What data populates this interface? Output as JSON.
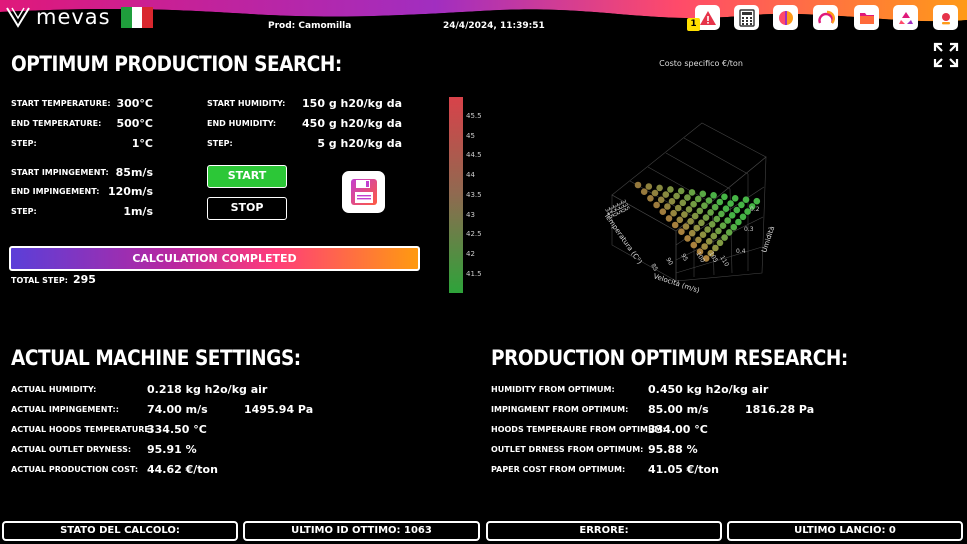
{
  "header": {
    "brand": "mevas",
    "product": "Prod: Camomilla",
    "datetime": "24/4/2024, 11:39:51",
    "warning_badge": "1",
    "icons": [
      "alert-icon",
      "calculator-icon",
      "gauge-icon",
      "arc-icon",
      "folder-icon",
      "recycle-icon",
      "settings-icon"
    ]
  },
  "search": {
    "title": "OPTIMUM PRODUCTION SEARCH:",
    "start_temperature_label": "START TEMPERATURE:",
    "start_temperature": "300°C",
    "end_temperature_label": "END TEMPERATURE:",
    "end_temperature": "500°C",
    "temp_step_label": "STEP:",
    "temp_step": "1°C",
    "start_humidity_label": "START HUMIDITY:",
    "start_humidity": "150 g h20/kg da",
    "end_humidity_label": "END HUMIDITY:",
    "end_humidity": "450 g h20/kg da",
    "hum_step_label": "STEP:",
    "hum_step": "5 g h20/kg da",
    "start_impingement_label": "START IMPINGEMENT:",
    "start_impingement": "85m/s",
    "end_impingement_label": "END IMPINGEMENT:",
    "end_impingement": "120m/s",
    "imp_step_label": "STEP:",
    "imp_step": "1m/s",
    "start_button": "START",
    "stop_button": "STOP",
    "status": "CALCULATION COMPLETED",
    "progress": 1.0,
    "total_step_label": "TOTAL STEP:",
    "total_step": "295"
  },
  "chart": {
    "title": "Costo specifico €/ton",
    "colorbar_ticks": [
      "45.5",
      "45",
      "44.5",
      "44",
      "43.5",
      "43",
      "42.5",
      "42",
      "41.5"
    ],
    "axis_temperature": "Temperatura (C°)",
    "axis_speed": "Velocità (m/s)",
    "axis_humidity": "Umidità",
    "speed_ticks": [
      "85",
      "90",
      "95",
      "100",
      "105",
      "110"
    ],
    "humidity_ticks": [
      "0.2",
      "0.3",
      "0.4"
    ],
    "temperature_ticks": [
      "335",
      "330",
      "325",
      "320",
      "315"
    ]
  },
  "actual": {
    "title": "ACTUAL MACHINE SETTINGS:",
    "humidity_label": "ACTUAL HUMIDITY:",
    "humidity": "0.218 kg h2o/kg air",
    "impingement_label": "ACTUAL IMPINGEMENT::",
    "impingement": "74.00 m/s",
    "impingement_pa": "1495.94 Pa",
    "hoods_label": "ACTUAL HOODS TEMPERATURE:",
    "hoods": "334.50 °C",
    "dryness_label": "ACTUAL OUTLET DRYNESS:",
    "dryness": "95.91 %",
    "cost_label": "ACTUAL PRODUCTION COST:",
    "cost": "44.62 €/ton"
  },
  "optimum": {
    "title": "PRODUCTION OPTIMUM RESEARCH:",
    "humidity_label": "HUMIDITY FROM OPTIMUM:",
    "humidity": "0.450 kg h2o/kg air",
    "impingement_label": "IMPINGMENT FROM OPTIMUM:",
    "impingement": "85.00 m/s",
    "impingement_pa": "1816.28 Pa",
    "hoods_label": "HOODS TEMPERAURE FROM OPTIMUM:",
    "hoods": "334.00 °C",
    "dryness_label": "OUTLET DRNESS FROM OPTIMUM:",
    "dryness": "95.88 %",
    "cost_label": "PAPER COST FROM OPTIMUM:",
    "cost": "41.05 €/ton"
  },
  "footer": {
    "stato": "STATO DEL CALCOLO:",
    "ultimo_id": "ULTIMO ID OTTIMO: 1063",
    "errore": "ERRORE:",
    "ultimo_lancio": "ULTIMO LANCIO: 0"
  }
}
